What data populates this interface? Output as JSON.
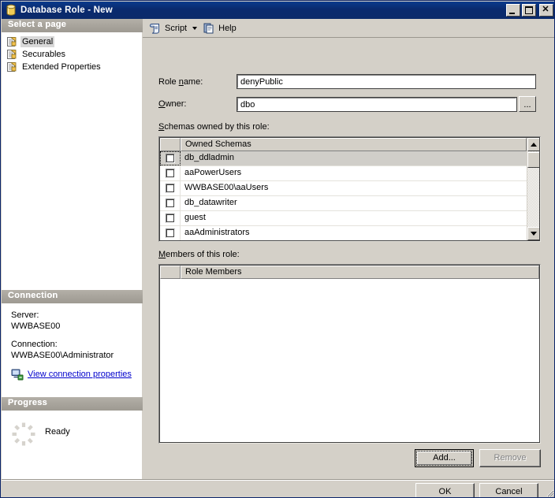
{
  "window": {
    "title": "Database Role - New",
    "title_icon": "database-icon",
    "controls": {
      "minimize": "minimize-icon",
      "maximize": "maximize-icon",
      "close": "✕"
    },
    "colors": {
      "titlebar_start": "#0a3a8c",
      "titlebar_end": "#0b2a6a",
      "face": "#d4d0c8",
      "link": "#0000cc",
      "selection": "#d0cec9"
    }
  },
  "sidebar": {
    "page_header": "Select a page",
    "items": [
      {
        "label": "General",
        "icon": "page-icon",
        "selected": true
      },
      {
        "label": "Securables",
        "icon": "page-icon",
        "selected": false
      },
      {
        "label": "Extended Properties",
        "icon": "page-icon",
        "selected": false
      }
    ],
    "connection": {
      "header": "Connection",
      "server_label": "Server:",
      "server_value": "WWBASE00",
      "connection_label": "Connection:",
      "connection_value": "WWBASE00\\Administrator",
      "link_text": "View connection properties",
      "link_icon": "server-connection-icon"
    },
    "progress": {
      "header": "Progress",
      "status": "Ready",
      "spinner_icon": "progress-spinner-icon"
    }
  },
  "toolbar": {
    "script_label": "Script",
    "script_icon": "script-icon",
    "script_dropdown_icon": "chevron-down-icon",
    "help_label": "Help",
    "help_icon": "help-icon"
  },
  "form": {
    "role_name_label_pre": "Role ",
    "role_name_label_accel": "n",
    "role_name_label_post": "ame:",
    "role_name_label": "Role name:",
    "role_name_value": "denyPublic",
    "role_name_placeholder": "",
    "owner_label": "Owner:",
    "owner_label_accel": "O",
    "owner_value": "dbo",
    "owner_placeholder": "",
    "browse_label": "..."
  },
  "schemas": {
    "section_label": "Schemas owned by this role:",
    "section_label_accel": "S",
    "columns": [
      "",
      "Owned Schemas"
    ],
    "rows": [
      {
        "checked": false,
        "name": "db_ddladmin",
        "selected": true,
        "focused": true
      },
      {
        "checked": false,
        "name": "aaPowerUsers",
        "selected": false,
        "focused": false
      },
      {
        "checked": false,
        "name": "WWBASE00\\aaUsers",
        "selected": false,
        "focused": false
      },
      {
        "checked": false,
        "name": "db_datawriter",
        "selected": false,
        "focused": false
      },
      {
        "checked": false,
        "name": "guest",
        "selected": false,
        "focused": false
      },
      {
        "checked": false,
        "name": "aaAdministrators",
        "selected": false,
        "focused": false
      }
    ],
    "scrollbar": {
      "up_icon": "scroll-up-arrow-icon",
      "down_icon": "scroll-down-arrow-icon"
    }
  },
  "members": {
    "section_label": "Members of this role:",
    "section_label_accel": "M",
    "columns": [
      "",
      "Role Members"
    ],
    "rows": [],
    "add_label": "Add...",
    "add_focused": true,
    "remove_label": "Remove",
    "remove_disabled": true
  },
  "dialog_buttons": {
    "ok_label": "OK",
    "cancel_label": "Cancel"
  }
}
